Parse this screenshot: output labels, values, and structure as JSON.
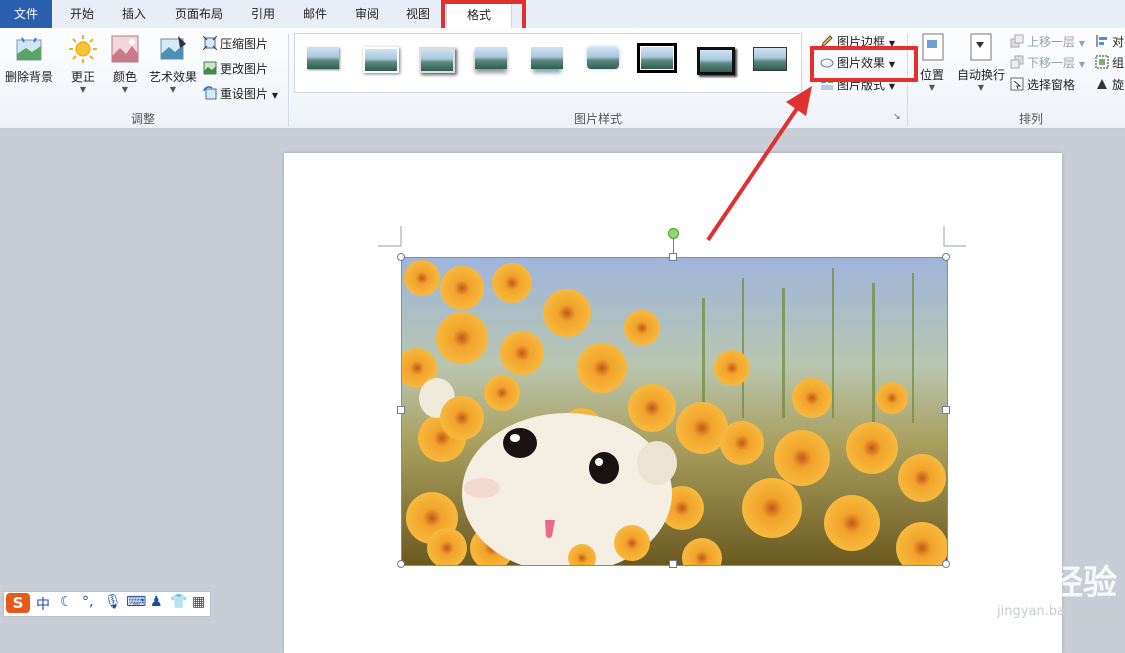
{
  "tabs": [
    {
      "label": "文件"
    },
    {
      "label": "开始"
    },
    {
      "label": "插入"
    },
    {
      "label": "页面布局"
    },
    {
      "label": "引用"
    },
    {
      "label": "邮件"
    },
    {
      "label": "审阅"
    },
    {
      "label": "视图"
    },
    {
      "label": "格式"
    }
  ],
  "ribbon": {
    "adjust": {
      "group_label": "调整",
      "remove_background": "删除背景",
      "corrections": "更正",
      "color": "颜色",
      "artistic_effects": "艺术效果",
      "compress_pictures": "压缩图片",
      "change_picture": "更改图片",
      "reset_picture": "重设图片"
    },
    "picture_styles": {
      "group_label": "图片样式",
      "picture_border": "图片边框",
      "picture_effects": "图片效果",
      "picture_layout": "图片版式",
      "thumbnails": 9
    },
    "arrange": {
      "group_label": "排列",
      "position": "位置",
      "wrap_text": "自动换行",
      "bring_forward": "上移一层",
      "send_backward": "下移一层",
      "selection_pane": "选择窗格",
      "align": "对",
      "group": "组",
      "rotate": "旋"
    }
  },
  "ime": {
    "mode": "中"
  },
  "watermark": {
    "main": "Bai 经验",
    "sub": "jingyan.baidu.com"
  },
  "colors": {
    "annotation": "#e03030",
    "file_tab": "#2a5fb0"
  }
}
